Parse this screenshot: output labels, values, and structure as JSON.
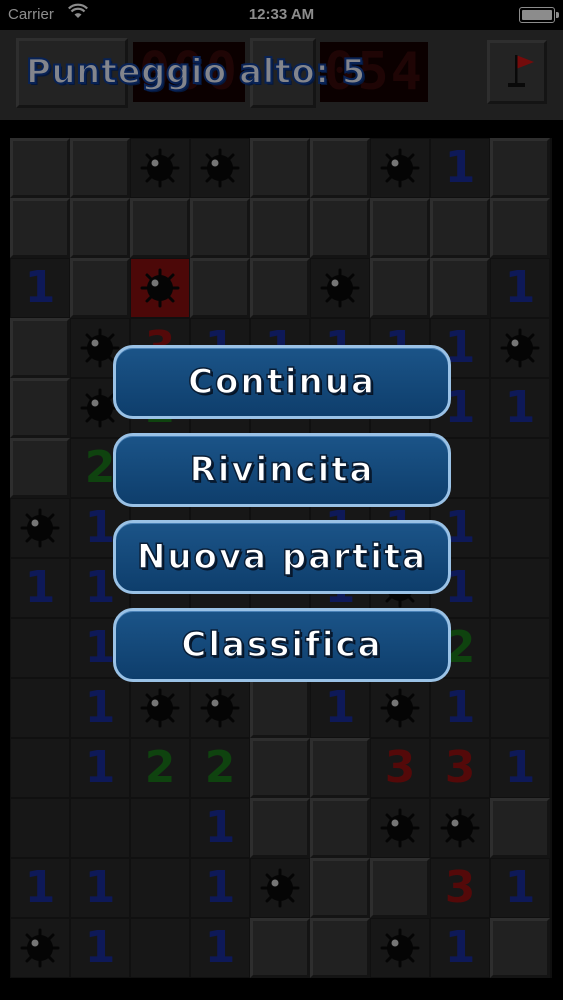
{
  "status_bar": {
    "carrier": "Carrier",
    "time": "12:33 AM"
  },
  "header": {
    "high_score_label": "Punteggio alto: 5",
    "mines_counter": "000",
    "timer": "054"
  },
  "board": {
    "rows": [
      [
        "C",
        "C",
        "M",
        "M",
        "C",
        "C",
        "M",
        "1",
        "C"
      ],
      [
        "C",
        "C",
        "C",
        "C",
        "C",
        "C",
        "C",
        "C",
        "C"
      ],
      [
        "1",
        "C",
        "X",
        "C",
        "C",
        "M",
        "C",
        "C",
        "1"
      ],
      [
        "C",
        "M",
        "3",
        "1",
        "1",
        "1",
        "1",
        "1",
        "M"
      ],
      [
        "C",
        "M",
        "2",
        "",
        "",
        "",
        "",
        "1",
        "1"
      ],
      [
        "C",
        "2",
        "",
        "",
        "",
        "",
        "",
        "",
        ""
      ],
      [
        "M",
        "1",
        "",
        "",
        "",
        "1",
        "1",
        "1",
        ""
      ],
      [
        "1",
        "1",
        "",
        "",
        "",
        "1",
        "M",
        "1",
        ""
      ],
      [
        "",
        "1",
        "",
        "",
        "",
        "",
        "",
        "2",
        ""
      ],
      [
        "",
        "1",
        "M",
        "M",
        "C",
        "1",
        "M",
        "1",
        ""
      ],
      [
        "",
        "1",
        "2",
        "2",
        "C",
        "C",
        "3",
        "3",
        "1"
      ],
      [
        "",
        "",
        "",
        "1",
        "C",
        "C",
        "M",
        "M",
        "C"
      ],
      [
        "1",
        "1",
        "",
        "1",
        "M",
        "C",
        "C",
        "3",
        "1"
      ],
      [
        "M",
        "1",
        "",
        "1",
        "C",
        "C",
        "M",
        "1",
        "C"
      ]
    ],
    "number_colors": {
      "1": "#1a2fa0",
      "2": "#1c7a1c",
      "3": "#9a1212"
    }
  },
  "menu": {
    "continue_label": "Continua",
    "rematch_label": "Rivincita",
    "new_game_label": "Nuova partita",
    "leaderboard_label": "Classifica"
  },
  "icons": {
    "flag": "flag-icon",
    "mine": "mine-icon",
    "wifi": "wifi-icon",
    "battery": "battery-icon"
  }
}
